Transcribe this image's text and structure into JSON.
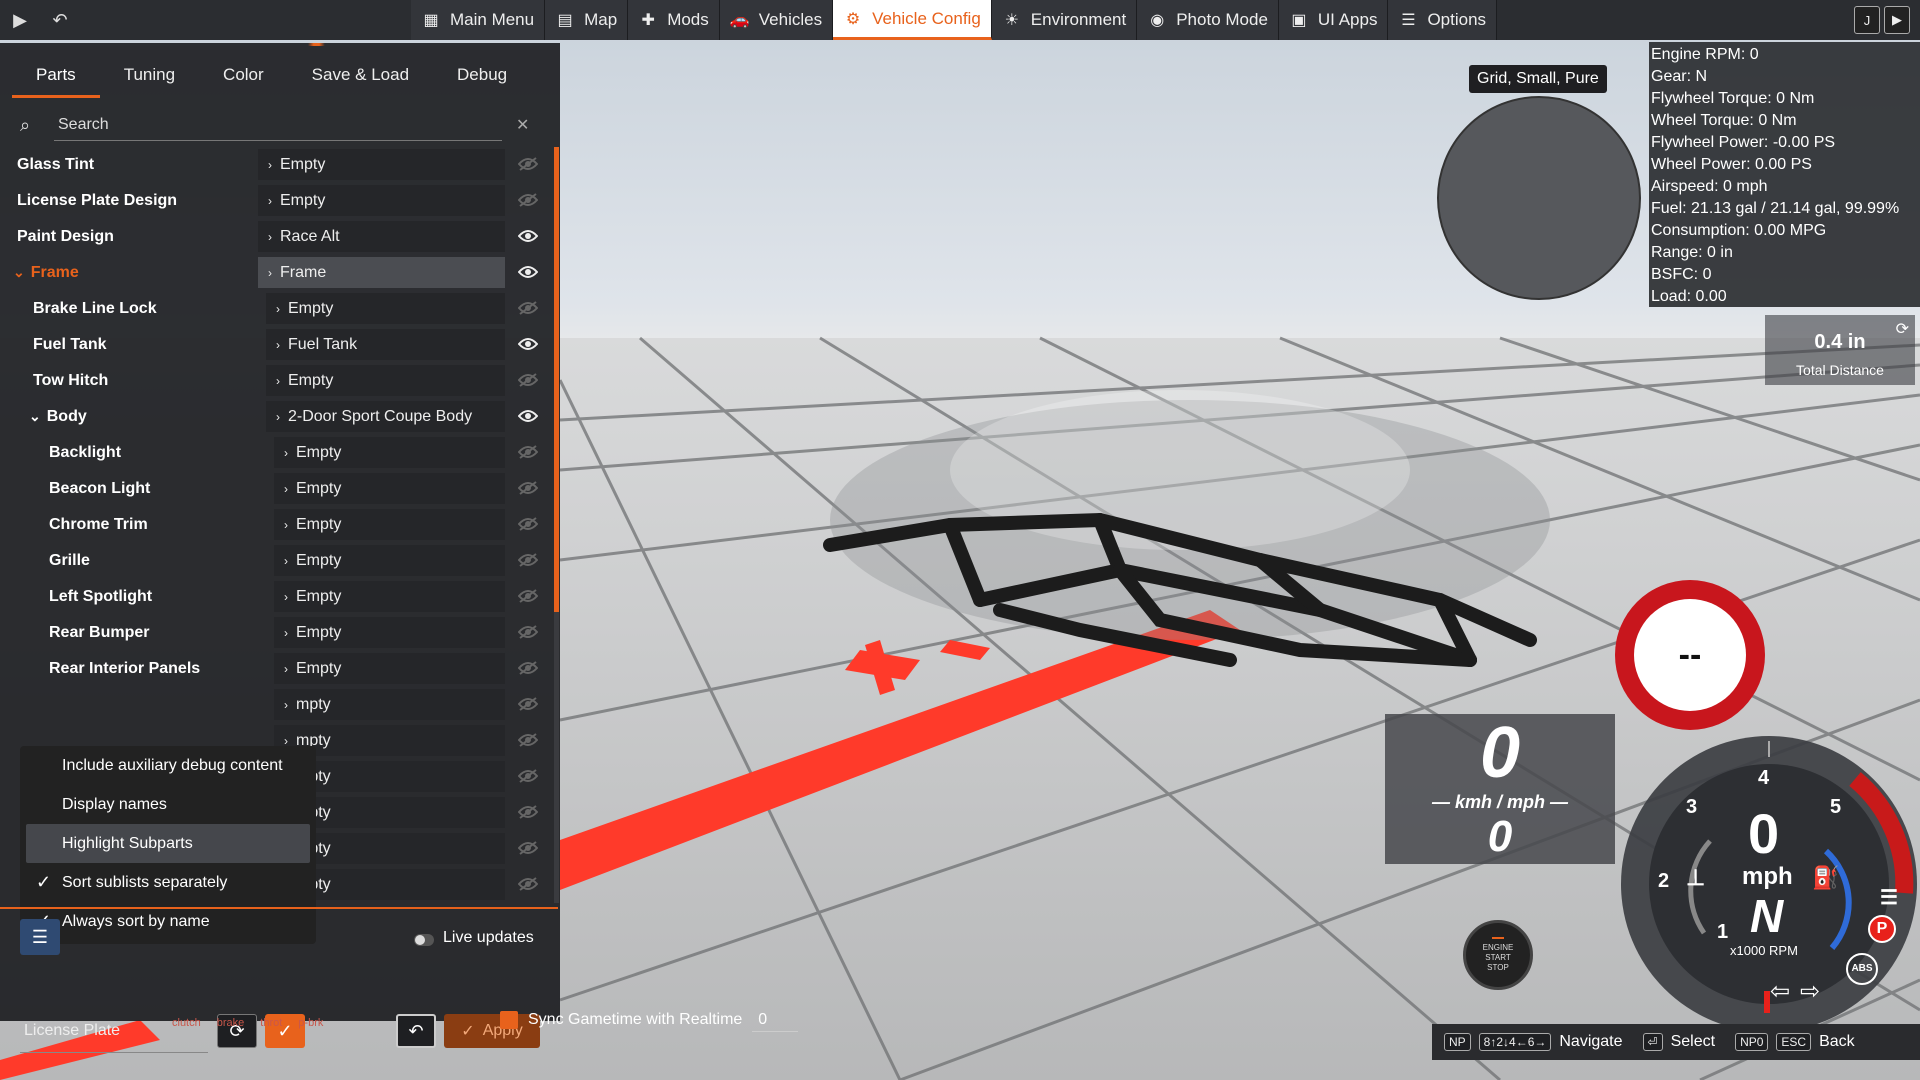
{
  "topbar": {
    "menu": [
      {
        "label": "Main Menu",
        "icon": "main-menu-icon",
        "glyph": "▦",
        "active": false
      },
      {
        "label": "Map",
        "icon": "map-icon",
        "glyph": "▤",
        "active": false
      },
      {
        "label": "Mods",
        "icon": "mods-icon",
        "glyph": "✚",
        "active": false
      },
      {
        "label": "Vehicles",
        "icon": "vehicles-icon",
        "glyph": "🚗",
        "active": false
      },
      {
        "label": "Vehicle Config",
        "icon": "vehicle-config-icon",
        "glyph": "⚙",
        "active": true
      },
      {
        "label": "Environment",
        "icon": "environment-icon",
        "glyph": "☀",
        "active": false
      },
      {
        "label": "Photo Mode",
        "icon": "camera-icon",
        "glyph": "◉",
        "active": false
      },
      {
        "label": "UI Apps",
        "icon": "ui-apps-icon",
        "glyph": "▣",
        "active": false
      },
      {
        "label": "Options",
        "icon": "options-icon",
        "glyph": "☰",
        "active": false
      }
    ],
    "right_key": "J"
  },
  "panel": {
    "tabs": [
      "Parts",
      "Tuning",
      "Color",
      "Save & Load",
      "Debug"
    ],
    "search_placeholder": "Search",
    "rows": [
      {
        "name": "Glass Tint",
        "value": "Empty",
        "indent": 0,
        "eye": "off"
      },
      {
        "name": "License Plate Design",
        "value": "Empty",
        "indent": 0,
        "eye": "off"
      },
      {
        "name": "Paint Design",
        "value": "Race Alt",
        "indent": 0,
        "eye": "on"
      },
      {
        "name": "Frame",
        "value": "Frame",
        "indent": 0,
        "eye": "on",
        "expanded": true,
        "highlight": true
      },
      {
        "name": "Brake Line Lock",
        "value": "Empty",
        "indent": 1,
        "eye": "off"
      },
      {
        "name": "Fuel Tank",
        "value": "Fuel Tank",
        "indent": 1,
        "eye": "on"
      },
      {
        "name": "Tow Hitch",
        "value": "Empty",
        "indent": 1,
        "eye": "off"
      },
      {
        "name": "Body",
        "value": "2-Door Sport Coupe Body",
        "indent": 1,
        "eye": "on",
        "expanded": true
      },
      {
        "name": "Backlight",
        "value": "Empty",
        "indent": 2,
        "eye": "off"
      },
      {
        "name": "Beacon Light",
        "value": "Empty",
        "indent": 2,
        "eye": "off"
      },
      {
        "name": "Chrome Trim",
        "value": "Empty",
        "indent": 2,
        "eye": "off"
      },
      {
        "name": "Grille",
        "value": "Empty",
        "indent": 2,
        "eye": "off"
      },
      {
        "name": "Left Spotlight",
        "value": "Empty",
        "indent": 2,
        "eye": "off"
      },
      {
        "name": "Rear Bumper",
        "value": "Empty",
        "indent": 2,
        "eye": "off"
      },
      {
        "name": "Rear Interior Panels",
        "value": "Empty",
        "indent": 2,
        "eye": "off"
      },
      {
        "name": "",
        "value": "mpty",
        "indent": 2,
        "eye": "off"
      },
      {
        "name": "",
        "value": "mpty",
        "indent": 2,
        "eye": "off"
      },
      {
        "name": "",
        "value": "mpty",
        "indent": 2,
        "eye": "off"
      },
      {
        "name": "",
        "value": "mpty",
        "indent": 2,
        "eye": "off"
      },
      {
        "name": "",
        "value": "mpty",
        "indent": 2,
        "eye": "off"
      },
      {
        "name": "",
        "value": "mpty",
        "indent": 2,
        "eye": "off"
      }
    ],
    "context_menu": [
      {
        "label": "Include auxiliary debug content",
        "checked": false
      },
      {
        "label": "Display names",
        "checked": false
      },
      {
        "label": "Highlight Subparts",
        "checked": false,
        "highlight": true
      },
      {
        "label": "Sort sublists separately",
        "checked": true
      },
      {
        "label": "Always sort by name",
        "checked": true
      }
    ],
    "live_updates_label": "Live updates",
    "live_updates_on": false,
    "preset_name": "License Plate",
    "apply_label": "Apply"
  },
  "overlay": {
    "minimap_label": "Grid, Small, Pure",
    "debug_lines": [
      "Engine RPM: 0",
      "Gear: N",
      "Flywheel Torque: 0 Nm",
      "Wheel Torque: 0 Nm",
      "Flywheel Power: -0.00 PS",
      "Wheel Power: 0.00 PS",
      "Airspeed: 0 mph",
      "Fuel: 21.13 gal / 21.14 gal, 99.99%",
      "Consumption: 0.00 MPG",
      "Range: 0 in",
      "BSFC: 0",
      "Load: 0.00"
    ],
    "distance_value": "0.4 in",
    "distance_label": "Total Distance",
    "speed_limit": "--",
    "digital_speed_top": "0",
    "digital_unit": "— kmh / mph —",
    "digital_speed_bottom": "0",
    "engine_button": [
      "ENGINE",
      "START",
      "STOP"
    ],
    "gauge": {
      "speed": "0",
      "unit": "mph",
      "gear": "N",
      "rpm_label": "x1000 RPM",
      "ticks": [
        "1",
        "2",
        "3",
        "4",
        "5"
      ],
      "park_label": "P",
      "abs_label": "ABS"
    }
  },
  "bottom": {
    "sync_label": "Sync Gametime with Realtime",
    "sync_value": "0",
    "pedal_labels": [
      "clutch",
      "brake",
      "throt",
      "p-brk"
    ],
    "hints": [
      {
        "keys": [
          "NP",
          "8↑2↓4←6→"
        ],
        "label": "Navigate"
      },
      {
        "keys": [
          "⏎"
        ],
        "label": "Select"
      },
      {
        "keys": [
          "NP0",
          "ESC"
        ],
        "label": "Back"
      }
    ]
  },
  "colors": {
    "accent": "#e8621c",
    "panel_bg": "#1e1f22",
    "topbar_bg": "#2b2d31",
    "speed_sign_red": "#c8161d"
  }
}
